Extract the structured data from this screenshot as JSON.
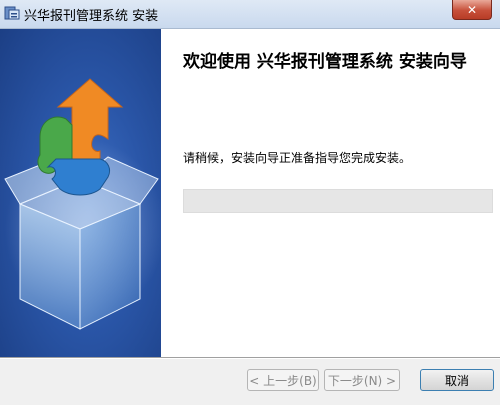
{
  "window": {
    "title": "兴华报刊管理系统 安装",
    "close_label": "✕"
  },
  "content": {
    "heading": "欢迎使用 兴华报刊管理系统 安装向导",
    "message": "请稍候，安装向导正准备指导您完成安装。",
    "progress": 0
  },
  "footer": {
    "back_label": "< 上一步(B)",
    "next_label": "下一步(N) >",
    "cancel_label": "取消",
    "back_enabled": false,
    "next_enabled": false
  },
  "icons": {
    "app": "installer-app-icon",
    "banner": "puzzle-box-graphic"
  },
  "colors": {
    "banner_blue": "#2a56a8",
    "puzzle_orange": "#f08a24",
    "puzzle_green": "#4aa84a",
    "puzzle_blue": "#2f7fd0"
  }
}
